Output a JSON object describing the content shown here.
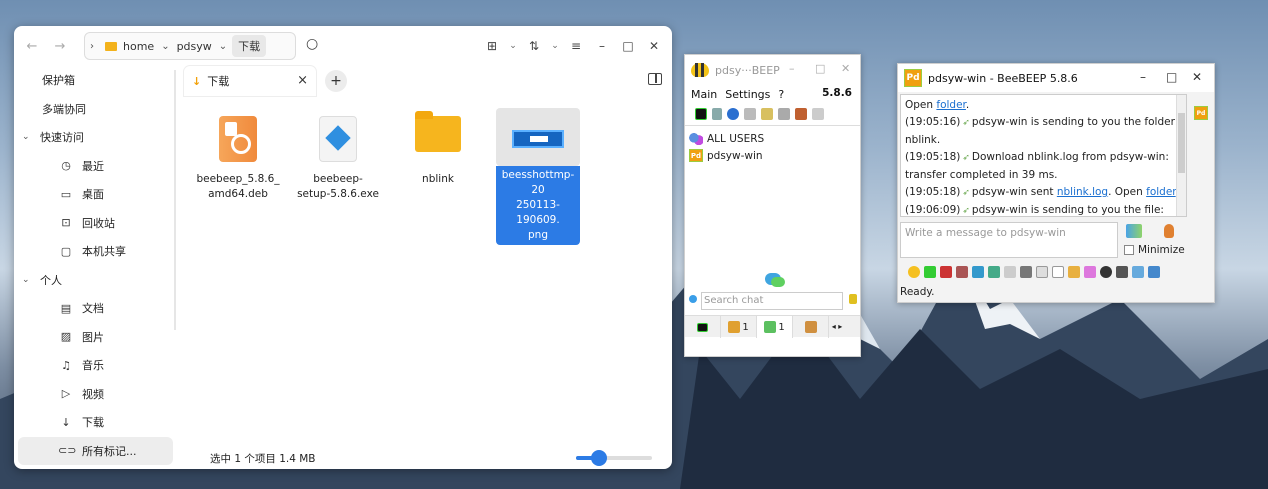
{
  "file_manager": {
    "breadcrumb": [
      "home",
      "pdsyw",
      "下载"
    ],
    "sidebar": {
      "top_items": [
        "保护箱",
        "多端协同"
      ],
      "quick_access": {
        "label": "快速访问",
        "items": [
          {
            "icon": "clock-icon",
            "label": "最近"
          },
          {
            "icon": "monitor-icon",
            "label": "桌面"
          },
          {
            "icon": "trash-icon",
            "label": "回收站"
          },
          {
            "icon": "folder-icon",
            "label": "本机共享"
          }
        ]
      },
      "personal": {
        "label": "个人",
        "items": [
          {
            "icon": "document-icon",
            "label": "文档"
          },
          {
            "icon": "image-icon",
            "label": "图片"
          },
          {
            "icon": "music-icon",
            "label": "音乐"
          },
          {
            "icon": "video-icon",
            "label": "视频"
          },
          {
            "icon": "download-icon",
            "label": "下载"
          }
        ]
      },
      "tags_label": "所有标记..."
    },
    "tab": {
      "label": "下载",
      "close": "×",
      "add": "+"
    },
    "files": [
      {
        "name": "beebeep_5.8.6_amd64.deb",
        "line1": "beebeep_5.8.6_",
        "line2": "amd64.deb",
        "icon": "deb-package-icon"
      },
      {
        "name": "beebeep-setup-5.8.6.exe",
        "line1": "beebeep-",
        "line2": "setup-5.8.6.exe",
        "icon": "exe-installer-icon"
      },
      {
        "name": "nblink",
        "line1": "nblink",
        "line2": "",
        "icon": "folder-icon"
      },
      {
        "name": "beesshottmp-20250113-190609.png",
        "line1": "beesshottmp-20",
        "line2": "250113-190609.",
        "line3": "png",
        "icon": "image-thumbnail"
      }
    ],
    "status": "选中 1 个项目   1.4 MB",
    "zoom_level": 0.3
  },
  "beebeep_main": {
    "title": "pdsy···BEEP",
    "menu": [
      "Main",
      "Settings",
      "?"
    ],
    "version": "5.8.6",
    "users": [
      {
        "label": "ALL USERS",
        "icon": "all-users-icon"
      },
      {
        "label": "pdsyw-win",
        "icon": "pd-avatar"
      }
    ],
    "search_placeholder": "Search chat",
    "tabs": [
      {
        "icon": "monitor-icon",
        "count": ""
      },
      {
        "icon": "users-icon",
        "count": "1"
      },
      {
        "icon": "chat-icon",
        "count": "1"
      },
      {
        "icon": "groups-icon",
        "count": ""
      }
    ]
  },
  "beebeep_chat": {
    "title": "pdsyw-win - BeeBEEP 5.8.6",
    "avatar": "Pd",
    "log": [
      {
        "text": "Open ",
        "link": "folder",
        "after": "."
      },
      {
        "time": "(19:05:16)",
        "text": "pdsyw-win is sending to you the folder: nblink."
      },
      {
        "time": "(19:05:18)",
        "text": "Download nblink.log from pdsyw-win: transfer completed in 39 ms."
      },
      {
        "time": "(19:05:18)",
        "text": "pdsyw-win sent ",
        "link": "nblink.log",
        "after": ". Open ",
        "link2": "folder",
        "after2": "."
      },
      {
        "time": "(19:06:09)",
        "text": "pdsyw-win is sending to you the file:"
      }
    ],
    "input_placeholder": "Write a message to pdsyw-win",
    "minimize_label": "Minimize",
    "status": "Ready."
  }
}
